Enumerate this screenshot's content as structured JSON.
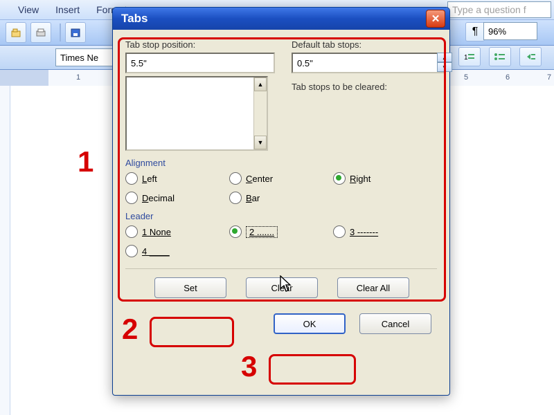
{
  "menubar": {
    "view": "View",
    "insert": "Insert",
    "format": "Format"
  },
  "help_placeholder": "Type a question f",
  "zoom": "96%",
  "font_name": "Times Ne",
  "ruler_numbers": [
    "1",
    "5",
    "6",
    "7"
  ],
  "dialog": {
    "title": "Tabs",
    "tab_stop_label": "Tab stop position:",
    "tab_stop_value": "5.5\"",
    "default_stops_label": "Default tab stops:",
    "default_stops_value": "0.5\"",
    "cleared_label": "Tab stops to be cleared:",
    "alignment_title": "Alignment",
    "alignment": {
      "left": {
        "text": "Left",
        "u": "L"
      },
      "center": {
        "text": "Center",
        "u": "C"
      },
      "right": {
        "text": "Right",
        "u": "R"
      },
      "decimal": {
        "text": "Decimal",
        "u": "D"
      },
      "bar": {
        "text": "Bar",
        "u": "B"
      }
    },
    "alignment_selected": "right",
    "leader_title": "Leader",
    "leader": {
      "none": "1 None",
      "dots": "2 .......",
      "dashes": "3 -------",
      "under": "4 ____"
    },
    "leader_selected": "dots",
    "buttons": {
      "set": "Set",
      "clear": "Clear",
      "clear_all": "Clear All",
      "ok": "OK",
      "cancel": "Cancel"
    }
  },
  "annotations": {
    "n1": "1",
    "n2": "2",
    "n3": "3"
  }
}
